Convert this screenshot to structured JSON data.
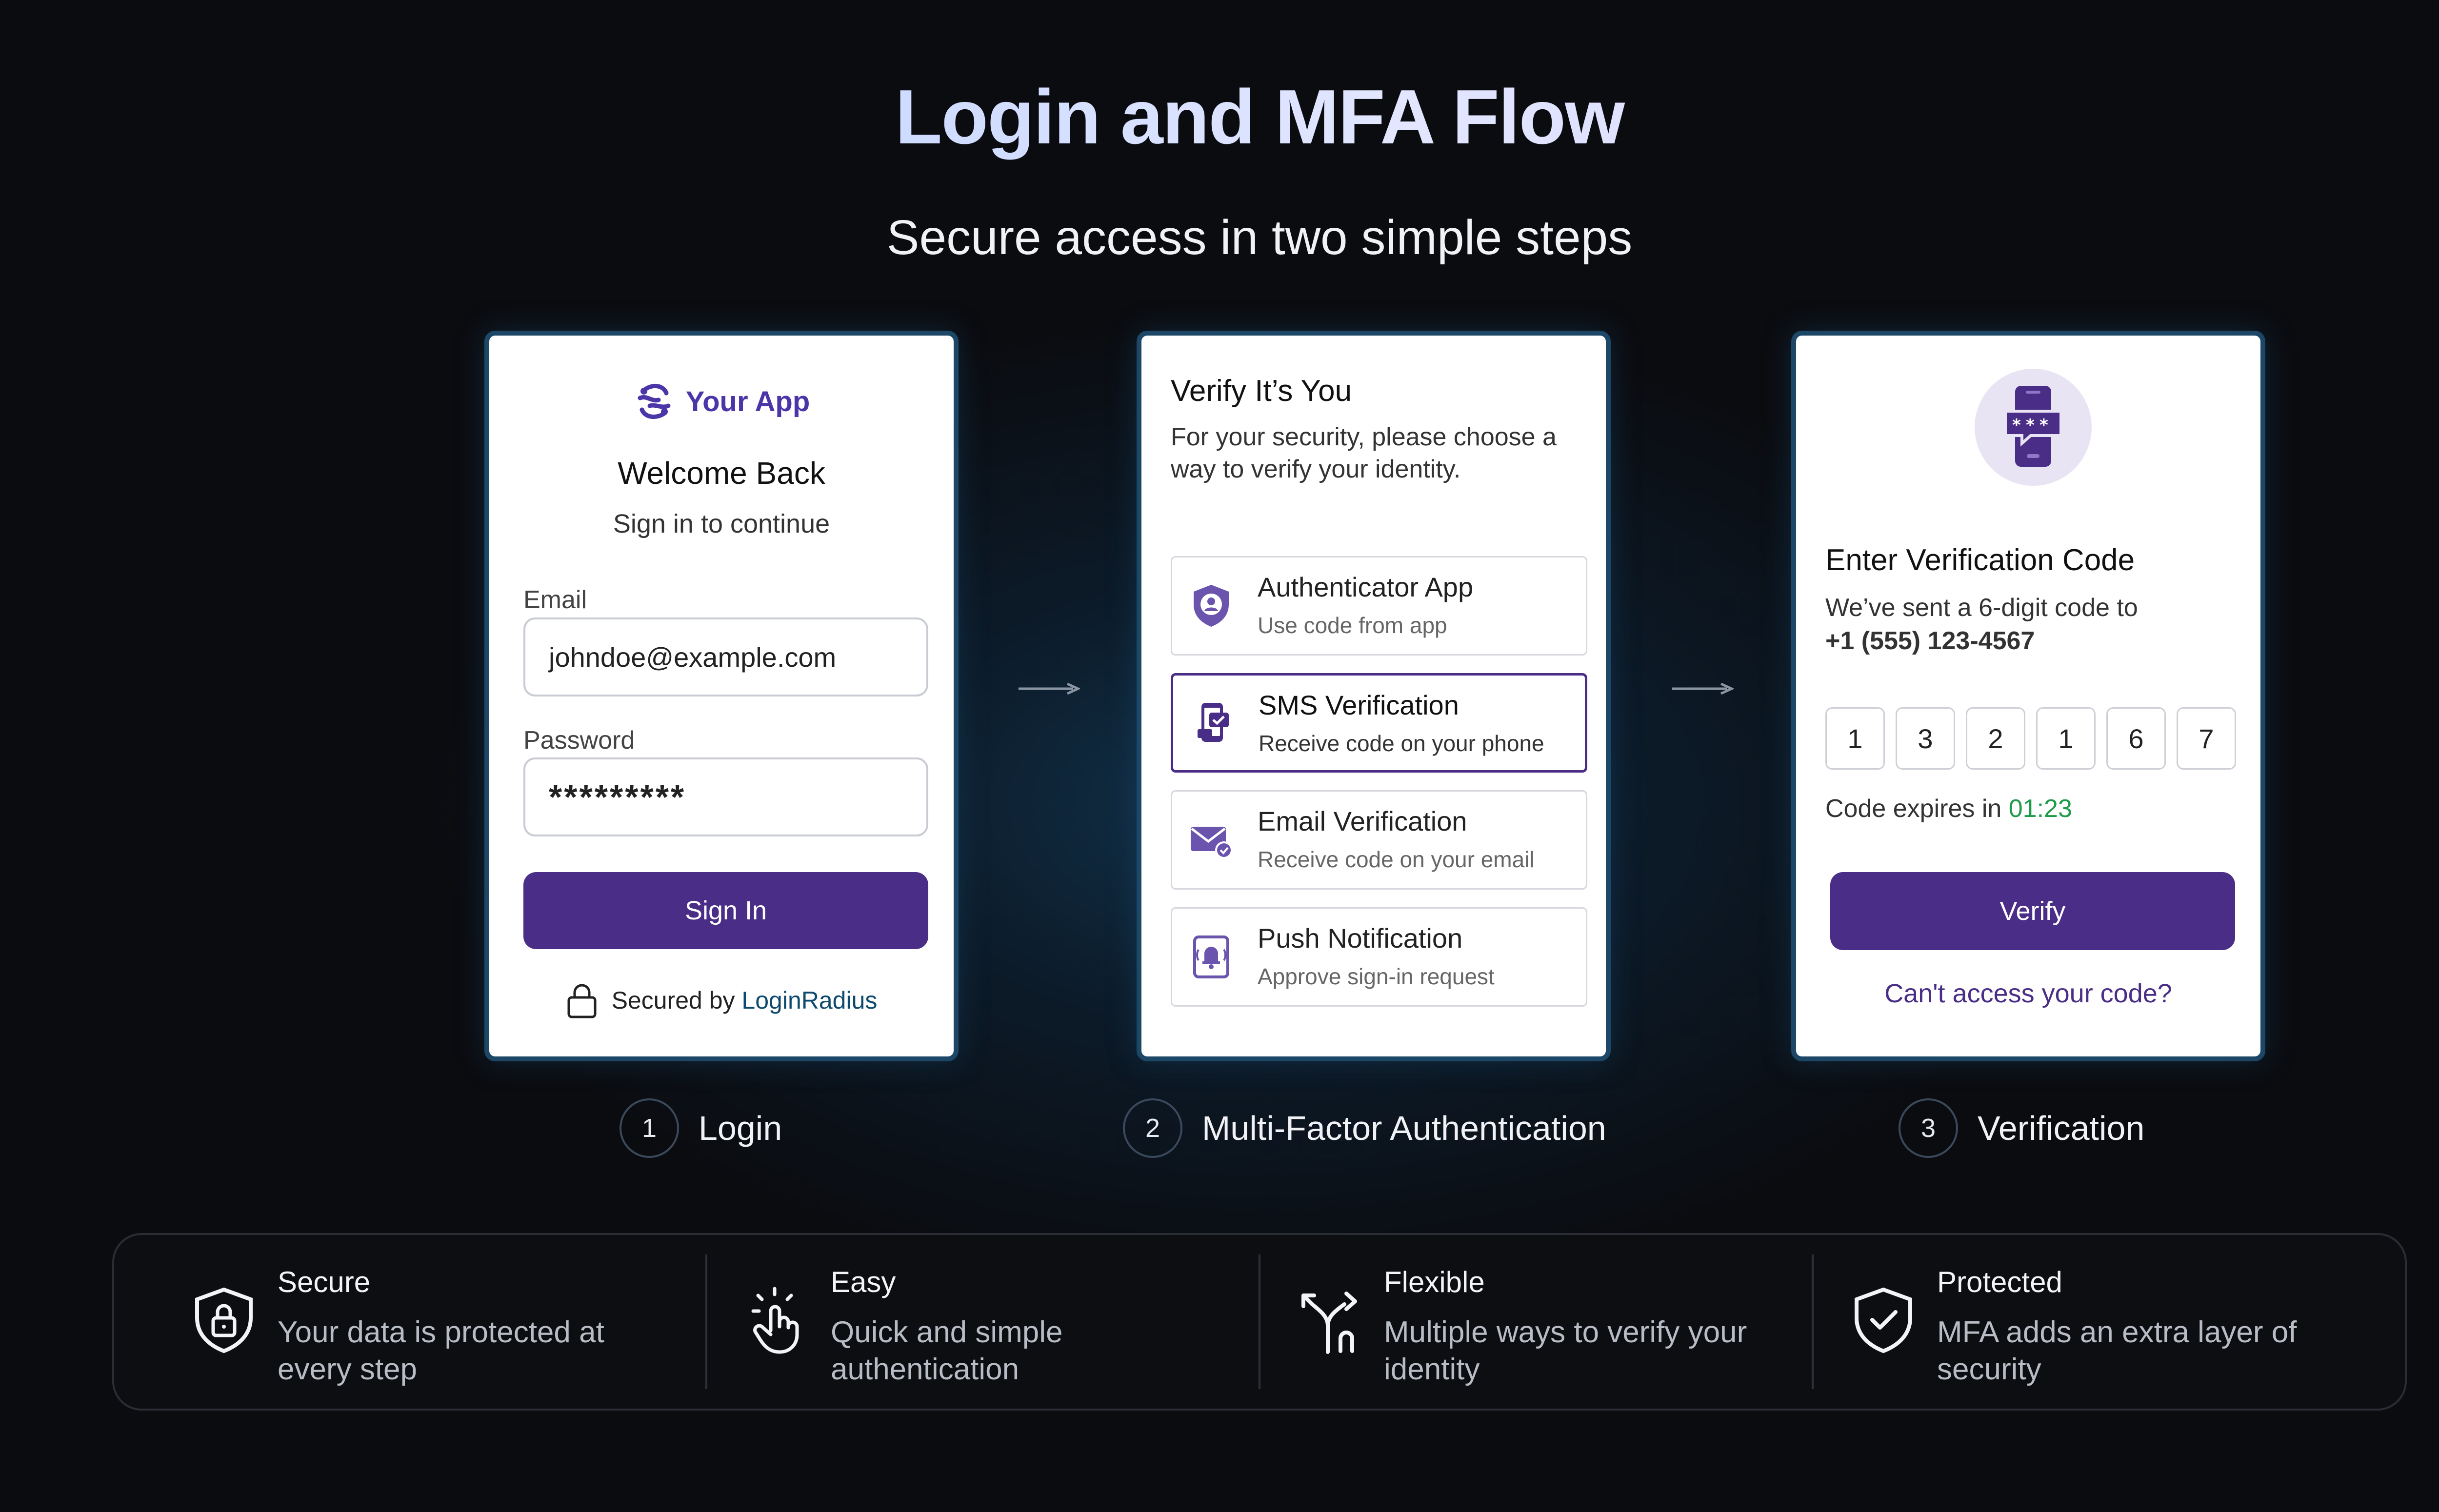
{
  "header": {
    "title": "Login and MFA Flow",
    "subtitle": "Secure access in two simple steps"
  },
  "login_card": {
    "app_name": "Your App",
    "title": "Welcome Back",
    "subtitle": "Sign in to continue",
    "email_label": "Email",
    "email_value": "johndoe@example.com",
    "password_label": "Password",
    "password_value": "*********",
    "sign_in_label": "Sign In",
    "secured_by": "Secured by",
    "provider": "LoginRadius"
  },
  "mfa_card": {
    "title": "Verify It’s You",
    "description": "For your security, please choose a way to verify your identity.",
    "options": [
      {
        "title": "Authenticator App",
        "subtitle": "Use code from app",
        "icon": "shield-user-icon",
        "selected": false
      },
      {
        "title": "SMS Verification",
        "subtitle": "Receive code on your phone",
        "icon": "phone-message-icon",
        "selected": true
      },
      {
        "title": "Email Verification",
        "subtitle": "Receive code on your email",
        "icon": "envelope-check-icon",
        "selected": false
      },
      {
        "title": "Push Notification",
        "subtitle": "Approve sign-in request",
        "icon": "bell-phone-icon",
        "selected": false
      }
    ]
  },
  "verify_card": {
    "title": "Enter Verification Code",
    "description": "We’ve sent a 6-digit code to",
    "phone": "+1 (555) 123-4567",
    "digits": [
      "1",
      "3",
      "2",
      "1",
      "6",
      "7"
    ],
    "expires_label": "Code expires in",
    "timer": "01:23",
    "verify_label": "Verify",
    "cant_access": "Can't access your code?"
  },
  "steps": [
    {
      "number": "1",
      "label": "Login"
    },
    {
      "number": "2",
      "label": "Multi-Factor Authentication"
    },
    {
      "number": "3",
      "label": "Verification"
    }
  ],
  "features": [
    {
      "title": "Secure",
      "description": "Your data is protected at every step",
      "icon": "shield-lock-icon"
    },
    {
      "title": "Easy",
      "description": "Quick and simple authentication",
      "icon": "tap-hand-icon"
    },
    {
      "title": "Flexible",
      "description": "Multiple ways to verify your identity",
      "icon": "split-arrows-icon"
    },
    {
      "title": "Protected",
      "description": "MFA adds an extra layer of security",
      "icon": "shield-check-icon"
    }
  ],
  "colors": {
    "primary": "#4a2d86",
    "brand": "#4b35a8",
    "timer": "#1f9a4a",
    "card_border": "#1c4766",
    "background": "#0b0c10"
  }
}
